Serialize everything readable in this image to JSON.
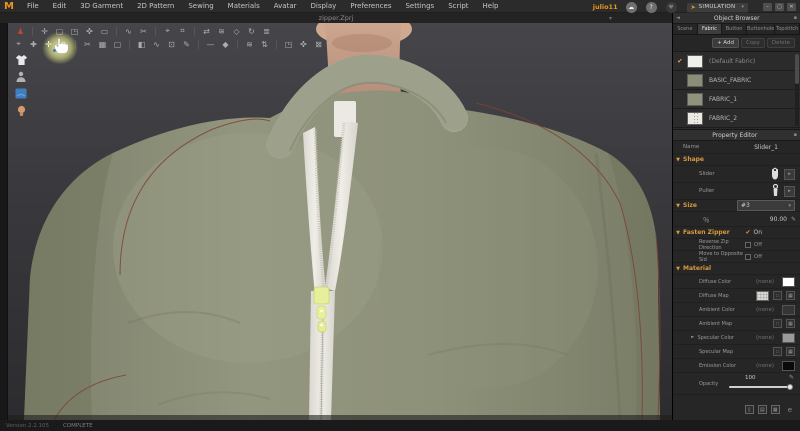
{
  "colors": {
    "accent": "#e8971e",
    "section": "#d89a3e",
    "jacket": "#8b8e77",
    "seam": "#7c4434",
    "slider_highlight": "#e7ef9a"
  },
  "menu": {
    "logo": "M",
    "items": [
      "File",
      "Edit",
      "3D Garment",
      "2D Pattern",
      "Sewing",
      "Materials",
      "Avatar",
      "Display",
      "Preferences",
      "Settings",
      "Script",
      "Help"
    ]
  },
  "topbar": {
    "username": "julio11",
    "cloud_glyph": "☁",
    "help_glyph": "?",
    "community_glyph": "♥",
    "simulation_label": "SIMULATION",
    "sim_bolt": "➤",
    "caret": "▾",
    "win_min": "–",
    "win_restore": "▢",
    "win_close": "✕"
  },
  "doc": {
    "title": "zipper.Zprj",
    "titlebar_caret": "▾"
  },
  "toolbar_row1": [
    {
      "name": "avatar-pose",
      "glyph": "♟",
      "color": "#c0452f"
    },
    {
      "sep": true
    },
    {
      "name": "hand",
      "glyph": "✛"
    },
    {
      "name": "zoom-rect",
      "glyph": "▢"
    },
    {
      "name": "frame",
      "glyph": "◳"
    },
    {
      "name": "gizmo",
      "glyph": "✜"
    },
    {
      "name": "plane",
      "glyph": "▭"
    },
    {
      "sep": true
    },
    {
      "name": "wind",
      "glyph": "∿"
    },
    {
      "name": "scissors",
      "glyph": "✂"
    },
    {
      "sep": true
    },
    {
      "name": "pin",
      "glyph": "⌖"
    },
    {
      "name": "grid",
      "glyph": "⌗"
    },
    {
      "sep": true
    },
    {
      "name": "swap",
      "glyph": "⇄"
    },
    {
      "name": "ripple",
      "glyph": "≋"
    },
    {
      "name": "diamond",
      "glyph": "◇"
    },
    {
      "name": "rotate",
      "glyph": "↻"
    },
    {
      "name": "list",
      "glyph": "≣"
    }
  ],
  "toolbar_row2": [
    {
      "name": "select",
      "glyph": "⌖"
    },
    {
      "name": "move",
      "glyph": "✚"
    },
    {
      "name": "grab-hand",
      "glyph": "✛",
      "active": true
    },
    {
      "name": "pin-point",
      "glyph": "●"
    },
    {
      "sep": true
    },
    {
      "name": "cut",
      "glyph": "✂"
    },
    {
      "name": "mesh",
      "glyph": "▦"
    },
    {
      "name": "box-select",
      "glyph": "▢"
    },
    {
      "sep": true
    },
    {
      "name": "shade",
      "glyph": "◧"
    },
    {
      "name": "curve",
      "glyph": "∿"
    },
    {
      "name": "texture",
      "glyph": "⊡"
    },
    {
      "name": "pen",
      "glyph": "✎"
    },
    {
      "sep": true
    },
    {
      "name": "measure",
      "glyph": "—"
    },
    {
      "name": "gem",
      "glyph": "◆"
    },
    {
      "sep": true
    },
    {
      "name": "wave",
      "glyph": "≋"
    },
    {
      "name": "flip",
      "glyph": "⇅"
    },
    {
      "sep": true
    },
    {
      "name": "frame-2",
      "glyph": "◳"
    },
    {
      "name": "cross",
      "glyph": "✜"
    },
    {
      "name": "erase",
      "glyph": "⊠"
    }
  ],
  "object_browser": {
    "title": "Object Browser",
    "collapse_glyph": "◄",
    "pin_glyph": "▪",
    "tabs": [
      "Scene",
      "Fabric",
      "Button",
      "Buttonhole",
      "Topstitch"
    ],
    "active_tab": "Fabric",
    "add_label": "+ Add",
    "copy_label": "Copy",
    "delete_label": "Delete",
    "check_glyph": "✔",
    "fabrics": [
      {
        "name": "(Default Fabric)",
        "checked": true
      },
      {
        "name": "BASIC_FABRIC"
      },
      {
        "name": "FABRIC_1"
      },
      {
        "name": "FABRIC_2"
      }
    ]
  },
  "property_editor": {
    "title": "Property Editor",
    "pin_glyph": "▪",
    "name_label": "Name",
    "name_value": "Slider_1",
    "shape_section": "Shape",
    "slider_label": "Slider",
    "puller_label": "Puller",
    "size_section": "Size",
    "size_value": "#3",
    "percent_glyph": "％",
    "percent_value": "90.00",
    "pencil_glyph": "✎",
    "fasten_section": "Fasten Zipper",
    "on_label": "On",
    "reverse_label": "Reverse Zip Direction",
    "reverse_value": "Off",
    "opposite_label": "Move to Opposite Sid",
    "opposite_value": "Off",
    "material_section": "Material",
    "diffuse_color_label": "Diffuse Color",
    "diffuse_map_label": "Diffuse Map",
    "ambient_color_label": "Ambient Color",
    "ambient_map_label": "Ambient Map",
    "specular_color_label": "Specular Color",
    "specular_map_label": "Specular Map",
    "emission_color_label": "Emission Color",
    "opacity_label": "Opacity",
    "none_value": "(none)",
    "opacity_value": "100",
    "expand_glyph": "►",
    "dots_glyph": "∷",
    "map_glyph": "▦",
    "layout_glyphs": [
      "▯",
      "▤",
      "▦"
    ],
    "e_glyph": "e"
  },
  "statusbar": {
    "version": "Version 2.2.105",
    "state": "COMPLETE"
  }
}
